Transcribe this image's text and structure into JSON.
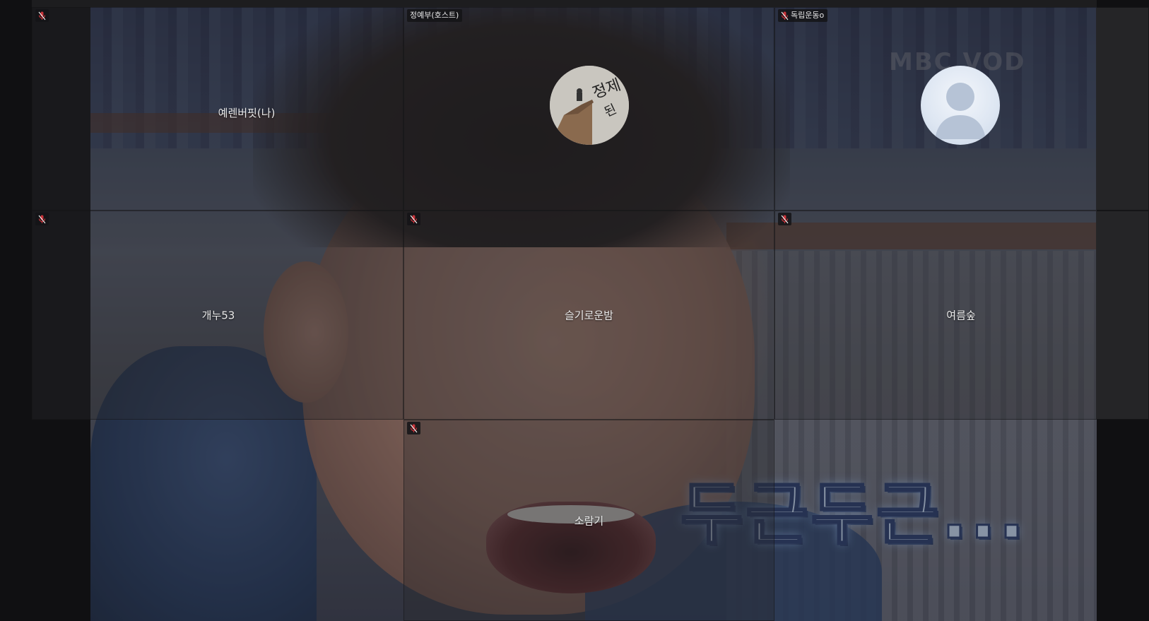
{
  "meeting": {
    "participants": [
      {
        "name": "예렌버핏(나)",
        "tag": "",
        "muted": true,
        "avatar": "none"
      },
      {
        "name": "",
        "tag": "정예부(호스트)",
        "muted": false,
        "avatar": "photo"
      },
      {
        "name": "",
        "tag": "독립운동o",
        "muted": true,
        "avatar": "default-person-icon"
      },
      {
        "name": "개누53",
        "tag": "",
        "muted": true,
        "avatar": "none"
      },
      {
        "name": "슬기로운밤",
        "tag": "",
        "muted": true,
        "avatar": "none"
      },
      {
        "name": "여름숲",
        "tag": "",
        "muted": true,
        "avatar": "none"
      },
      {
        "name": "소람기",
        "tag": "",
        "muted": true,
        "avatar": "none"
      }
    ],
    "shared_video": {
      "brand_watermark": "MBC VOD",
      "caption": "두근두근..."
    },
    "colors": {
      "mute_icon": "#c8343a",
      "tile_border": "#2a2a2c",
      "name_text": "#eaeaea"
    }
  }
}
